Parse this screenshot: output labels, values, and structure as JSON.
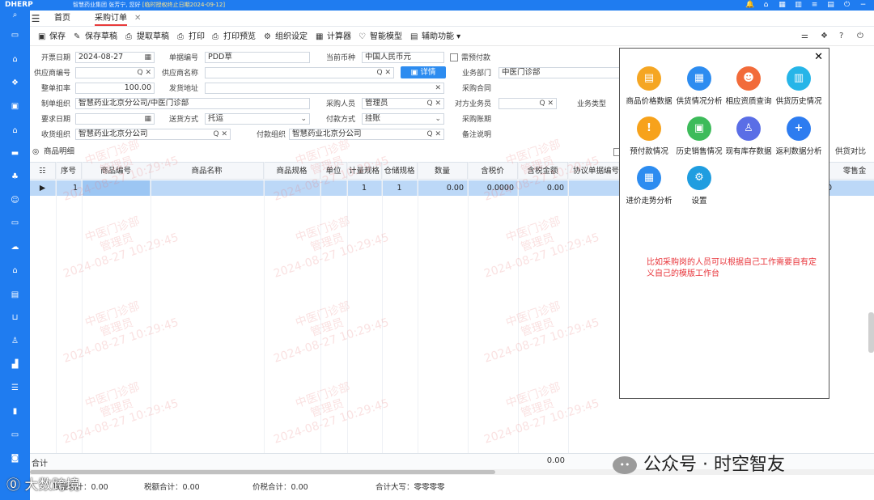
{
  "topbar": {
    "logo": "DHERP",
    "company": "智慧药业集团",
    "greeting": "张芳宁, 您好",
    "warning": "[临时授权终止日期2024-09-12]"
  },
  "tabs": [
    {
      "label": "首页"
    },
    {
      "label": "采购订单"
    }
  ],
  "toolbar": {
    "save": "保存",
    "save_draft": "保存草稿",
    "fetch_draft": "提取草稿",
    "print": "打印",
    "print_preview": "打印预览",
    "org_setting": "组织设定",
    "calculator": "计算器",
    "smart_model": "智能模型",
    "aux_func": "辅助功能"
  },
  "form": {
    "open_date_label": "开票日期",
    "open_date": "2024-08-27",
    "doc_no_label": "单据编号",
    "doc_no": "PDD草",
    "currency_label": "当前币种",
    "currency": "中国人民币元",
    "need_prepay_label": "需预付款",
    "supplier_code_label": "供应商编号",
    "supplier_code": "",
    "supplier_name_label": "供应商名称",
    "supplier_name": "",
    "detail_btn": "详情",
    "dept_label": "业务部门",
    "dept": "中医门诊部",
    "discount_label": "整单扣率",
    "discount": "100.00",
    "ship_addr_label": "发货地址",
    "ship_addr": "",
    "purchase_contract_label": "采购合同",
    "maker_org_label": "制单组织",
    "maker_org": "智慧药业北京分公司/中医门诊部",
    "buyer_label": "采购人员",
    "buyer": "管理员",
    "counterpart_label": "对方业务员",
    "counterpart": "",
    "biz_type_label": "业务类型",
    "req_date_label": "要求日期",
    "req_date": "",
    "delivery_label": "送货方式",
    "delivery": "托运",
    "pay_method_label": "付款方式",
    "pay_method": "挂账",
    "pay_period_label": "采购账期",
    "recv_org_label": "收货组织",
    "recv_org": "智慧药业北京分公司",
    "pay_org_label": "付款组织",
    "pay_org": "智慧药业北京分公司",
    "remark_label": "备注说明"
  },
  "section": {
    "title": "商品明细",
    "compare": "供货对比"
  },
  "grid": {
    "columns": [
      "序号",
      "商品编号",
      "商品名称",
      "商品规格",
      "单位",
      "计量规格",
      "仓储规格",
      "数量",
      "含税价",
      "含税金额",
      "协议单据编号",
      "零售金"
    ],
    "row": {
      "seq": "1",
      "meas": "1",
      "store": "1",
      "qty": "0.00",
      "price": "0.0000",
      "amount": "0.00",
      "tail": "0"
    },
    "total_label": "合计",
    "total_amount": "0.00"
  },
  "footer": {
    "qty_total": "数量合计：0.00",
    "tax_total": "税额合计：0.00",
    "price_total": "价税合计：0.00",
    "big_total": "合计大写：零零零零"
  },
  "watermark": {
    "org": "中医门诊部",
    "user": "管理员",
    "time": "2024-08-27 10:29:45"
  },
  "popup": {
    "tiles": [
      {
        "label": "商品价格数据",
        "color": "#f5a623"
      },
      {
        "label": "供货情况分析",
        "color": "#2d8cf0"
      },
      {
        "label": "相应资质查询",
        "color": "#f26b3a"
      },
      {
        "label": "供货历史情况",
        "color": "#26b5e8"
      },
      {
        "label": "预付款情况",
        "color": "#f7a21b"
      },
      {
        "label": "历史销售情况",
        "color": "#3dbb5a"
      },
      {
        "label": "现有库存数据",
        "color": "#5a6ee6"
      },
      {
        "label": "返利数据分析",
        "color": "#2d7cf0"
      },
      {
        "label": "进价走势分析",
        "color": "#2d8cf0"
      },
      {
        "label": "设置",
        "color": "#1f9de0"
      }
    ],
    "note": "比如采购岗的人员可以根据自己工作需要自有定义自己的模版工作台"
  },
  "overlay": {
    "wechat": "公众号 · 时空智友",
    "brand": "大数跨境"
  }
}
